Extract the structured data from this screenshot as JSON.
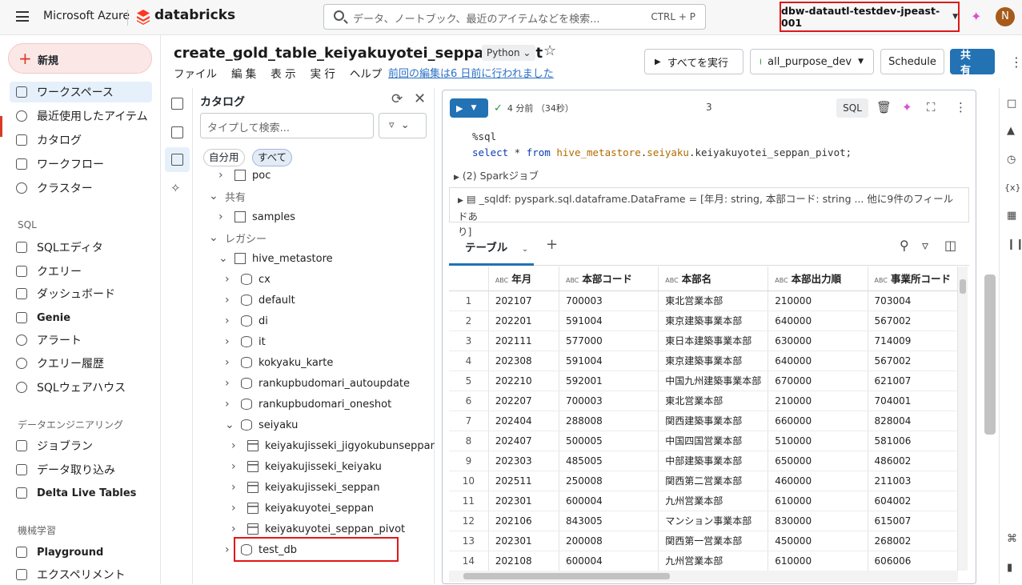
{
  "topbar": {
    "brand": "Microsoft Azure",
    "product": "databricks",
    "search_placeholder": "データ、ノートブック、最近のアイテムなどを検索...",
    "search_shortcut": "CTRL + P",
    "workspace": "dbw-datautl-testdev-jpeast-001",
    "avatar_initial": "N"
  },
  "sidebar": {
    "new_label": "新規",
    "items": [
      {
        "label": "ワークスペース",
        "icon": "workspace-icon"
      },
      {
        "label": "最近使用したアイテム",
        "icon": "clock-icon"
      },
      {
        "label": "カタログ",
        "icon": "catalog-icon"
      },
      {
        "label": "ワークフロー",
        "icon": "workflow-icon"
      },
      {
        "label": "クラスター",
        "icon": "cloud-icon"
      }
    ],
    "sql_section": "SQL",
    "sql_items": [
      {
        "label": "SQLエディタ"
      },
      {
        "label": "クエリー"
      },
      {
        "label": "ダッシュボード"
      },
      {
        "label": "Genie"
      },
      {
        "label": "アラート"
      },
      {
        "label": "クエリー履歴"
      },
      {
        "label": "SQLウェアハウス"
      }
    ],
    "de_section": "データエンジニアリング",
    "de_items": [
      {
        "label": "ジョブラン"
      },
      {
        "label": "データ取り込み"
      },
      {
        "label": "Delta Live Tables"
      }
    ],
    "ml_section": "機械学習",
    "ml_items": [
      {
        "label": "Playground"
      },
      {
        "label": "エクスペリメント"
      }
    ]
  },
  "notebook": {
    "title": "create_gold_table_keiyakuyotei_seppan_pivot",
    "language": "Python",
    "menu": [
      "ファイル",
      "編 集",
      "表 示",
      "実 行",
      "ヘルプ"
    ],
    "last_edit": "前回の編集は6 日前に行われました",
    "run_all": "すべてを実行",
    "compute": "all_purpose_dev",
    "schedule": "Schedule",
    "share": "共 有"
  },
  "catalog": {
    "title": "カタログ",
    "search_placeholder": "タイプして検索...",
    "filter_mine": "自分用",
    "filter_all": "すべて",
    "tree": [
      {
        "label": "poc",
        "type": "folder",
        "depth": 2
      },
      {
        "label": "共有",
        "type": "section",
        "depth": 1
      },
      {
        "label": "samples",
        "type": "catalog",
        "depth": 2
      },
      {
        "label": "レガシー",
        "type": "section",
        "depth": 1
      },
      {
        "label": "hive_metastore",
        "type": "catalog",
        "depth": 2
      },
      {
        "label": "cx",
        "type": "db",
        "depth": 3
      },
      {
        "label": "default",
        "type": "db",
        "depth": 3
      },
      {
        "label": "di",
        "type": "db",
        "depth": 3
      },
      {
        "label": "it",
        "type": "db",
        "depth": 3
      },
      {
        "label": "kokyaku_karte",
        "type": "db",
        "depth": 3
      },
      {
        "label": "rankupbudomari_autoupdate",
        "type": "db",
        "depth": 3
      },
      {
        "label": "rankupbudomari_oneshot",
        "type": "db",
        "depth": 3
      },
      {
        "label": "seiyaku",
        "type": "db",
        "depth": 3,
        "open": true
      },
      {
        "label": "keiyakujisseki_jigyokubunseppan",
        "type": "tbl",
        "depth": 4
      },
      {
        "label": "keiyakujisseki_keiyaku",
        "type": "tbl",
        "depth": 4
      },
      {
        "label": "keiyakujisseki_seppan",
        "type": "tbl",
        "depth": 4
      },
      {
        "label": "keiyakuyotei_seppan",
        "type": "tbl",
        "depth": 4
      },
      {
        "label": "keiyakuyotei_seppan_pivot",
        "type": "tbl",
        "depth": 4
      },
      {
        "label": "test_db",
        "type": "db",
        "depth": 3
      }
    ]
  },
  "cell": {
    "status": "4 分前 （34秒）",
    "number": "3",
    "lang_badge": "SQL",
    "code_line1": "%sql",
    "code_kw1": "select",
    "code_mid": " * ",
    "code_kw2": "from",
    "code_ns1": "hive_metastore",
    "code_dot1": ".",
    "code_ns2": "seiyaku",
    "code_rest": ".keiyakuyotei_seppan_pivot;",
    "spark_jobs": "(2) Sparkジョブ",
    "df_line1": "_sqldf:  pyspark.sql.dataframe.DataFrame = [年月: string, 本部コード: string ... 他に9件のフィールドあ",
    "df_line2": "り]",
    "tab_label": "テーブル"
  },
  "table": {
    "columns": [
      "年月",
      "本部コード",
      "本部名",
      "本部出力順",
      "事業所コード"
    ],
    "rows": [
      [
        "1",
        "202107",
        "700003",
        "東北営業本部",
        "210000",
        "703004"
      ],
      [
        "2",
        "202201",
        "591004",
        "東京建築事業本部",
        "640000",
        "567002"
      ],
      [
        "3",
        "202111",
        "577000",
        "東日本建築事業本部",
        "630000",
        "714009"
      ],
      [
        "4",
        "202308",
        "591004",
        "東京建築事業本部",
        "640000",
        "567002"
      ],
      [
        "5",
        "202210",
        "592001",
        "中国九州建築事業本部",
        "670000",
        "621007"
      ],
      [
        "6",
        "202207",
        "700003",
        "東北営業本部",
        "210000",
        "704001"
      ],
      [
        "7",
        "202404",
        "288008",
        "関西建築事業本部",
        "660000",
        "828004"
      ],
      [
        "8",
        "202407",
        "500005",
        "中国四国営業本部",
        "510000",
        "581006"
      ],
      [
        "9",
        "202303",
        "485005",
        "中部建築事業本部",
        "650000",
        "486002"
      ],
      [
        "10",
        "202511",
        "250008",
        "関西第二営業本部",
        "460000",
        "211003"
      ],
      [
        "11",
        "202301",
        "600004",
        "九州営業本部",
        "610000",
        "604002"
      ],
      [
        "12",
        "202106",
        "843005",
        "マンション事業本部",
        "830000",
        "615007"
      ],
      [
        "13",
        "202301",
        "200008",
        "関西第一営業本部",
        "450000",
        "268002"
      ],
      [
        "14",
        "202108",
        "600004",
        "九州営業本部",
        "610000",
        "606006"
      ]
    ]
  }
}
